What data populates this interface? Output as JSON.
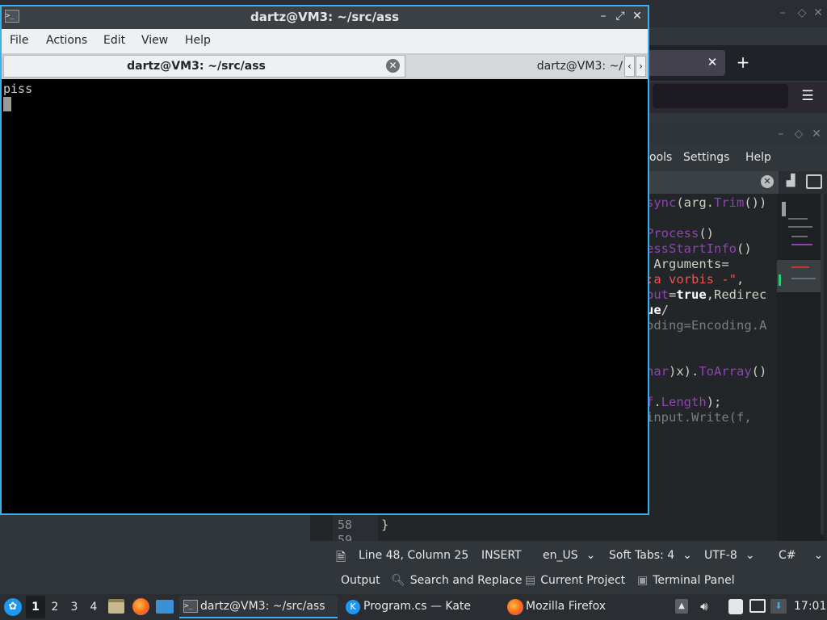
{
  "firefox": {
    "new_tab_icon": "plus-icon",
    "close_icon": "close-icon",
    "menu_icon": "hamburger-icon"
  },
  "kate": {
    "menu": [
      "ools",
      "Settings",
      "Help"
    ],
    "code_lines": [
      [
        {
          "t": "sync",
          "c": "fn"
        },
        {
          "t": "(",
          "c": "id"
        },
        {
          "t": "arg",
          "c": "id"
        },
        {
          "t": ".",
          "c": "id"
        },
        {
          "t": "Trim",
          "c": "fn"
        },
        {
          "t": "())",
          "c": "id"
        }
      ],
      [],
      [
        {
          "t": "Process",
          "c": "fn"
        },
        {
          "t": "()",
          "c": "id"
        }
      ],
      [
        {
          "t": "essStartInfo",
          "c": "fn"
        },
        {
          "t": "()",
          "c": "id"
        }
      ],
      [
        {
          "t": " Arguments=",
          "c": "id"
        }
      ],
      [
        {
          "t": ":a vorbis -\"",
          "c": "str"
        },
        {
          "t": ",",
          "c": "id"
        }
      ],
      [
        {
          "t": "out",
          "c": "fn"
        },
        {
          "t": "=",
          "c": "id"
        },
        {
          "t": "true",
          "c": "kw"
        },
        {
          "t": ",Redirec",
          "c": "id"
        }
      ],
      [
        {
          "t": "ue",
          "c": "kw"
        },
        {
          "t": "/",
          "c": "id"
        }
      ],
      [
        {
          "t": "oding=Encoding.A",
          "c": "dim"
        }
      ],
      [],
      [],
      [
        {
          "t": "har",
          "c": "fn"
        },
        {
          "t": ")x).",
          "c": "id"
        },
        {
          "t": "ToArray",
          "c": "fn"
        },
        {
          "t": "()",
          "c": "id"
        }
      ],
      [],
      [
        {
          "t": "f",
          "c": "fn"
        },
        {
          "t": ".",
          "c": "id"
        },
        {
          "t": "Length",
          "c": "fn"
        },
        {
          "t": ");",
          "c": "id"
        }
      ],
      [
        {
          "t": "input.Write(f,",
          "c": "dim"
        }
      ]
    ],
    "line_numbers": [
      "58",
      "59"
    ],
    "closing_brace": "}",
    "status": {
      "position": "Line 48, Column 25",
      "mode": "INSERT",
      "dictionary": "en_US",
      "indent": "Soft Tabs: 4",
      "encoding": "UTF-8",
      "syntax": "C#"
    },
    "toolviews": [
      "Output",
      "Search and Replace",
      "Current Project",
      "Terminal Panel"
    ]
  },
  "terminal": {
    "title": "dartz@VM3: ~/src/ass",
    "menu": [
      "File",
      "Actions",
      "Edit",
      "View",
      "Help"
    ],
    "tabs": [
      {
        "label": "dartz@VM3: ~/src/ass",
        "active": true
      },
      {
        "label": "dartz@VM3: ~/",
        "active": false
      }
    ],
    "output": "piss",
    "window_buttons": [
      "minimize-icon",
      "maximize-icon",
      "close-icon"
    ]
  },
  "taskbar": {
    "desktops": [
      "1",
      "2",
      "3",
      "4"
    ],
    "active_desktop": "1",
    "tasks": [
      {
        "label": "dartz@VM3: ~/src/ass",
        "icon": "terminal-icon"
      },
      {
        "label": "Program.cs  — Kate",
        "icon": "kate-icon"
      },
      {
        "label": "Mozilla Firefox",
        "icon": "firefox-icon"
      }
    ],
    "clock": "17:01"
  },
  "colors": {
    "accent": "#3daee9",
    "terminal_bg": "#000000",
    "panel_bg": "#2a2e32"
  }
}
